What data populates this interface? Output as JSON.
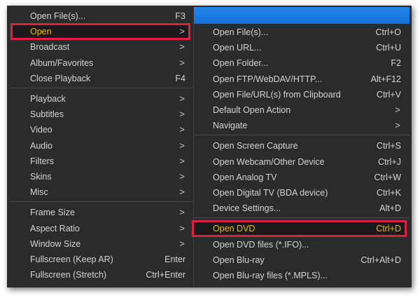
{
  "left_menu": {
    "groups": [
      {
        "items": [
          {
            "label": "Open File(s)...",
            "shortcut": "F3",
            "has_submenu": false
          },
          {
            "label": "Open",
            "shortcut": "",
            "has_submenu": true,
            "highlighted": true
          },
          {
            "label": "Broadcast",
            "shortcut": "",
            "has_submenu": true
          },
          {
            "label": "Album/Favorites",
            "shortcut": "",
            "has_submenu": true
          },
          {
            "label": "Close Playback",
            "shortcut": "F4",
            "has_submenu": false
          }
        ]
      },
      {
        "items": [
          {
            "label": "Playback",
            "shortcut": "",
            "has_submenu": true
          },
          {
            "label": "Subtitles",
            "shortcut": "",
            "has_submenu": true
          },
          {
            "label": "Video",
            "shortcut": "",
            "has_submenu": true
          },
          {
            "label": "Audio",
            "shortcut": "",
            "has_submenu": true
          },
          {
            "label": "Filters",
            "shortcut": "",
            "has_submenu": true
          },
          {
            "label": "Skins",
            "shortcut": "",
            "has_submenu": true
          },
          {
            "label": "Misc",
            "shortcut": "",
            "has_submenu": true
          }
        ]
      },
      {
        "items": [
          {
            "label": "Frame Size",
            "shortcut": "",
            "has_submenu": true
          },
          {
            "label": "Aspect Ratio",
            "shortcut": "",
            "has_submenu": true
          },
          {
            "label": "Window Size",
            "shortcut": "",
            "has_submenu": true
          },
          {
            "label": "Fullscreen (Keep AR)",
            "shortcut": "Enter",
            "has_submenu": false
          },
          {
            "label": "Fullscreen (Stretch)",
            "shortcut": "Ctrl+Enter",
            "has_submenu": false
          }
        ]
      }
    ]
  },
  "right_menu": {
    "groups": [
      {
        "items": [
          {
            "label": "Open File(s)...",
            "shortcut": "Ctrl+O",
            "has_submenu": false
          },
          {
            "label": "Open URL...",
            "shortcut": "Ctrl+U",
            "has_submenu": false
          },
          {
            "label": "Open Folder...",
            "shortcut": "F2",
            "has_submenu": false
          },
          {
            "label": "Open FTP/WebDAV/HTTP...",
            "shortcut": "Alt+F12",
            "has_submenu": false
          },
          {
            "label": "Open File/URL(s) from Clipboard",
            "shortcut": "Ctrl+V",
            "has_submenu": false
          },
          {
            "label": "Default Open Action",
            "shortcut": "",
            "has_submenu": true
          },
          {
            "label": "Navigate",
            "shortcut": "",
            "has_submenu": true
          }
        ]
      },
      {
        "items": [
          {
            "label": "Open Screen Capture",
            "shortcut": "Ctrl+S",
            "has_submenu": false
          },
          {
            "label": "Open Webcam/Other Device",
            "shortcut": "Ctrl+J",
            "has_submenu": false
          },
          {
            "label": "Open Analog TV",
            "shortcut": "Ctrl+W",
            "has_submenu": false
          },
          {
            "label": "Open Digital TV (BDA device)",
            "shortcut": "Ctrl+K",
            "has_submenu": false
          },
          {
            "label": "Device Settings...",
            "shortcut": "Alt+D",
            "has_submenu": false
          }
        ]
      },
      {
        "items": [
          {
            "label": "Open DVD",
            "shortcut": "Ctrl+D",
            "has_submenu": false,
            "highlighted": true
          },
          {
            "label": "Open DVD files (*.IFO)...",
            "shortcut": "",
            "has_submenu": false
          },
          {
            "label": "Open Blu-ray",
            "shortcut": "Ctrl+Alt+D",
            "has_submenu": false
          },
          {
            "label": "Open Blu-ray files (*.MPLS)...",
            "shortcut": "",
            "has_submenu": false
          }
        ]
      }
    ]
  },
  "colors": {
    "menu_bg": "#2b2b2b",
    "text": "#d4d4d4",
    "highlight_text": "#f0b800",
    "highlight_border": "#e02040",
    "window_strip": "#1670d8"
  },
  "icons": {
    "submenu_arrow": "chevron-right-icon"
  }
}
